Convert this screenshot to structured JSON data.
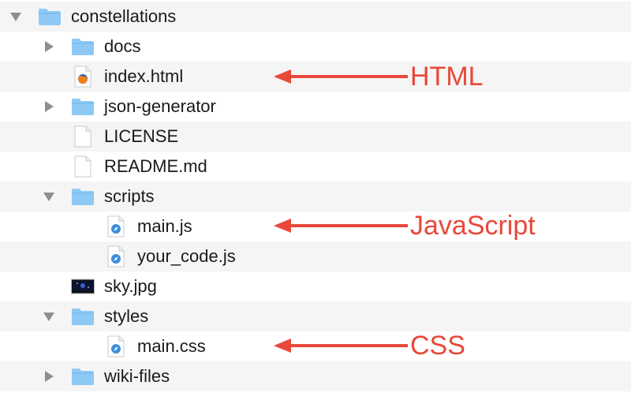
{
  "tree": {
    "items": [
      {
        "label": "constellations",
        "icon": "folder-icon",
        "disclosure": "expanded",
        "depth": 0
      },
      {
        "label": "docs",
        "icon": "folder-icon",
        "disclosure": "collapsed",
        "depth": 1
      },
      {
        "label": "index.html",
        "icon": "firefox-html-file-icon",
        "disclosure": "none",
        "depth": 1
      },
      {
        "label": "json-generator",
        "icon": "folder-icon",
        "disclosure": "collapsed",
        "depth": 1
      },
      {
        "label": "LICENSE",
        "icon": "blank-document-icon",
        "disclosure": "none",
        "depth": 1
      },
      {
        "label": "README.md",
        "icon": "blank-document-icon",
        "disclosure": "none",
        "depth": 1
      },
      {
        "label": "scripts",
        "icon": "folder-icon",
        "disclosure": "expanded",
        "depth": 1
      },
      {
        "label": "main.js",
        "icon": "safari-script-file-icon",
        "disclosure": "none",
        "depth": 2
      },
      {
        "label": "your_code.js",
        "icon": "safari-script-file-icon",
        "disclosure": "none",
        "depth": 2
      },
      {
        "label": "sky.jpg",
        "icon": "image-thumbnail-icon",
        "disclosure": "none",
        "depth": 1
      },
      {
        "label": "styles",
        "icon": "folder-icon",
        "disclosure": "expanded",
        "depth": 1
      },
      {
        "label": "main.css",
        "icon": "safari-script-file-icon",
        "disclosure": "none",
        "depth": 2
      },
      {
        "label": "wiki-files",
        "icon": "folder-icon",
        "disclosure": "collapsed",
        "depth": 1
      }
    ]
  },
  "annotations": {
    "html": "HTML",
    "javascript": "JavaScript",
    "css": "CSS"
  },
  "colors": {
    "annotation": "#e8483a",
    "folder": "#8ec9f5",
    "row_alt": "#f5f5f5"
  }
}
